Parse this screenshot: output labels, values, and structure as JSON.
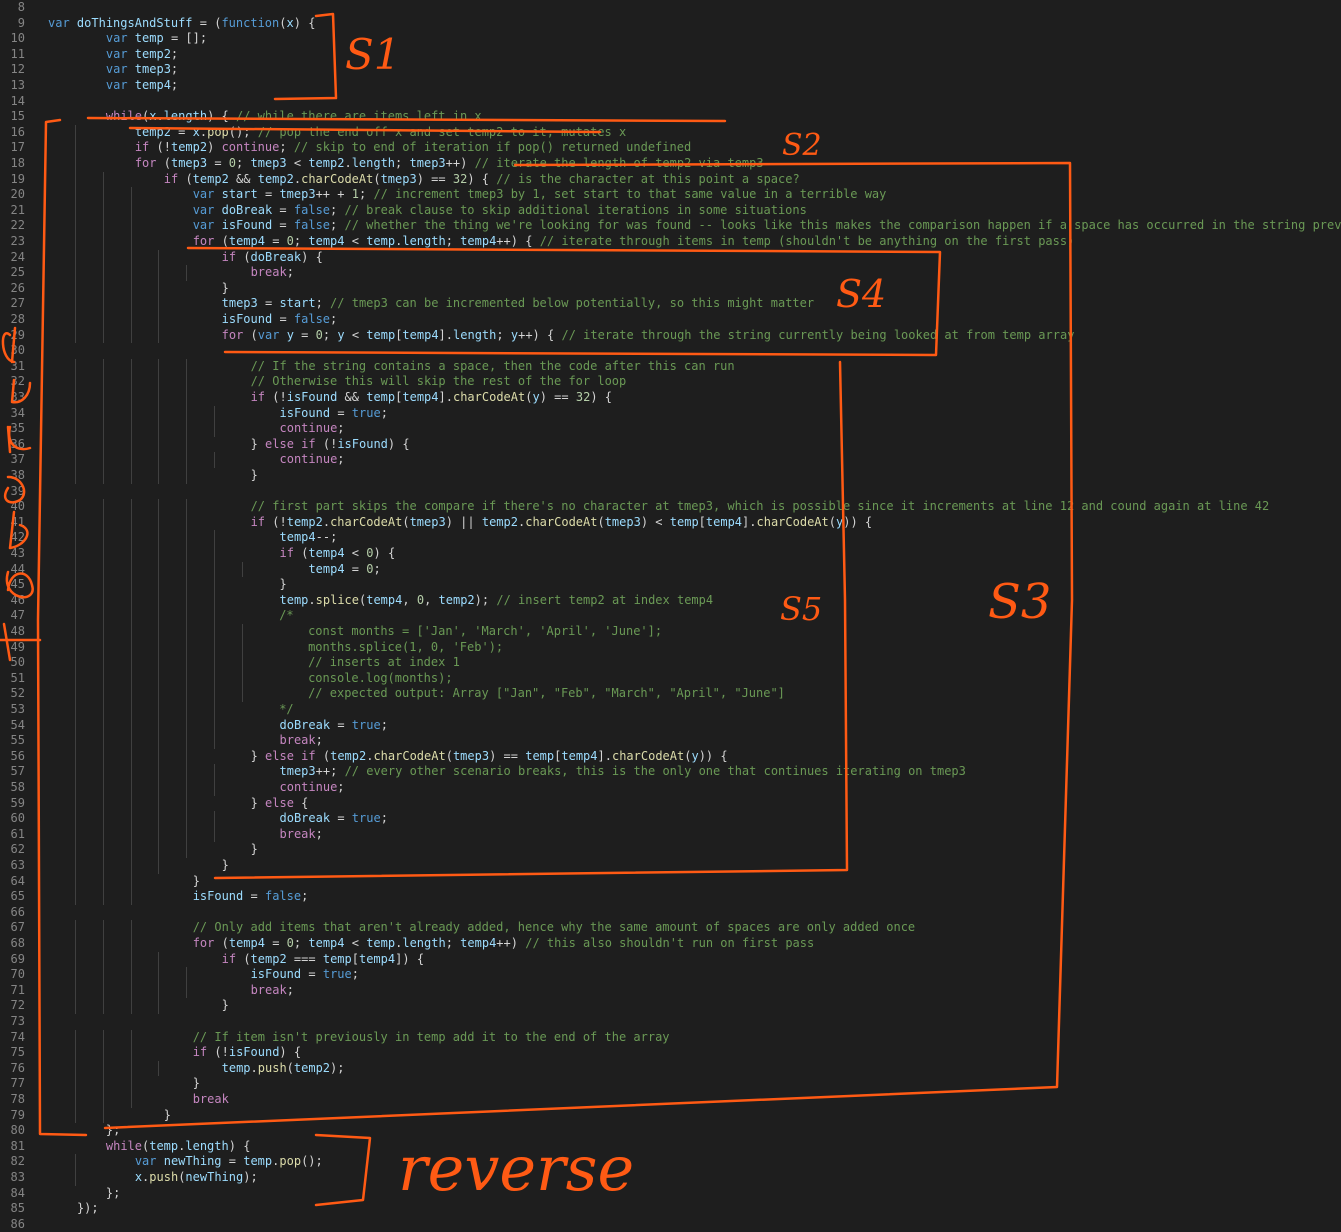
{
  "editor": {
    "first_line_number": 8,
    "lines": [
      "",
      "var doThingsAndStuff = (function(x) {",
      "        var temp = [];",
      "        var temp2;",
      "        var tmep3;",
      "        var temp4;",
      "",
      "        while(x.length) { // while there are items left in x",
      "            temp2 = x.pop(); // pop the end off x and set temp2 to it, mutates x",
      "            if (!temp2) continue; // skip to end of iteration if pop() returned undefined",
      "            for (tmep3 = 0; tmep3 < temp2.length; tmep3++) // iterate the length of temp2 via temp3",
      "                if (temp2 && temp2.charCodeAt(tmep3) == 32) { // is the character at this point a space?",
      "                    var start = tmep3++ + 1; // increment tmep3 by 1, set start to that same value in a terrible way",
      "                    var doBreak = false; // break clause to skip additional iterations in some situations",
      "                    var isFound = false; // whether the thing we're looking for was found -- looks like this makes the comparison happen if a space has occurred in the string previously",
      "                    for (temp4 = 0; temp4 < temp.length; temp4++) { // iterate through items in temp (shouldn't be anything on the first pass)",
      "                        if (doBreak) {",
      "                            break;",
      "                        }",
      "                        tmep3 = start; // tmep3 can be incremented below potentially, so this might matter",
      "                        isFound = false;",
      "                        for (var y = 0; y < temp[temp4].length; y++) { // iterate through the string currently being looked at from temp array",
      "",
      "                            // If the string contains a space, then the code after this can run",
      "                            // Otherwise this will skip the rest of the for loop",
      "                            if (!isFound && temp[temp4].charCodeAt(y) == 32) {",
      "                                isFound = true;",
      "                                continue;",
      "                            } else if (!isFound) {",
      "                                continue;",
      "                            }",
      "",
      "                            // first part skips the compare if there's no character at tmep3, which is possible since it increments at line 12 and cound again at line 42",
      "                            if (!temp2.charCodeAt(tmep3) || temp2.charCodeAt(tmep3) < temp[temp4].charCodeAt(y)) {",
      "                                temp4--;",
      "                                if (temp4 < 0) {",
      "                                    temp4 = 0;",
      "                                }",
      "                                temp.splice(temp4, 0, temp2); // insert temp2 at index temp4",
      "                                /*",
      "                                    const months = ['Jan', 'March', 'April', 'June'];",
      "                                    months.splice(1, 0, 'Feb');",
      "                                    // inserts at index 1",
      "                                    console.log(months);",
      "                                    // expected output: Array [\"Jan\", \"Feb\", \"March\", \"April\", \"June\"]",
      "                                */",
      "                                doBreak = true;",
      "                                break;",
      "                            } else if (temp2.charCodeAt(tmep3) == temp[temp4].charCodeAt(y)) {",
      "                                tmep3++; // every other scenario breaks, this is the only one that continues iterating on tmep3",
      "                                continue;",
      "                            } else {",
      "                                doBreak = true;",
      "                                break;",
      "                            }",
      "                        }",
      "                    }",
      "                    isFound = false;",
      "",
      "                    // Only add items that aren't already added, hence why the same amount of spaces are only added once",
      "                    for (temp4 = 0; temp4 < temp.length; temp4++) // this also shouldn't run on first pass",
      "                        if (temp2 === temp[temp4]) {",
      "                            isFound = true;",
      "                            break;",
      "                        }",
      "",
      "                    // If item isn't previously in temp add it to the end of the array",
      "                    if (!isFound) {",
      "                        temp.push(temp2);",
      "                    }",
      "                    break",
      "                }",
      "        };",
      "        while(temp.length) {",
      "            var newThing = temp.pop();",
      "            x.push(newThing);",
      "        };",
      "    });",
      ""
    ]
  },
  "annotations": {
    "labels": {
      "s1": "S1",
      "s2": "S2",
      "s3": "S3",
      "s4": "S4",
      "s5": "S5",
      "reverse": "reverse",
      "side_letters": [
        "b",
        "u",
        "b",
        "b",
        "l",
        "e"
      ]
    },
    "color": "#ff5a14"
  },
  "theme": {
    "background": "#1e1e1e",
    "line_number": "#858585",
    "keyword": "#569cd6",
    "control": "#c586c0",
    "variable": "#9cdcfe",
    "function": "#dcdcaa",
    "number": "#b5cea8",
    "string": "#ce9178",
    "comment": "#6a9955",
    "plain": "#d4d4d4"
  }
}
